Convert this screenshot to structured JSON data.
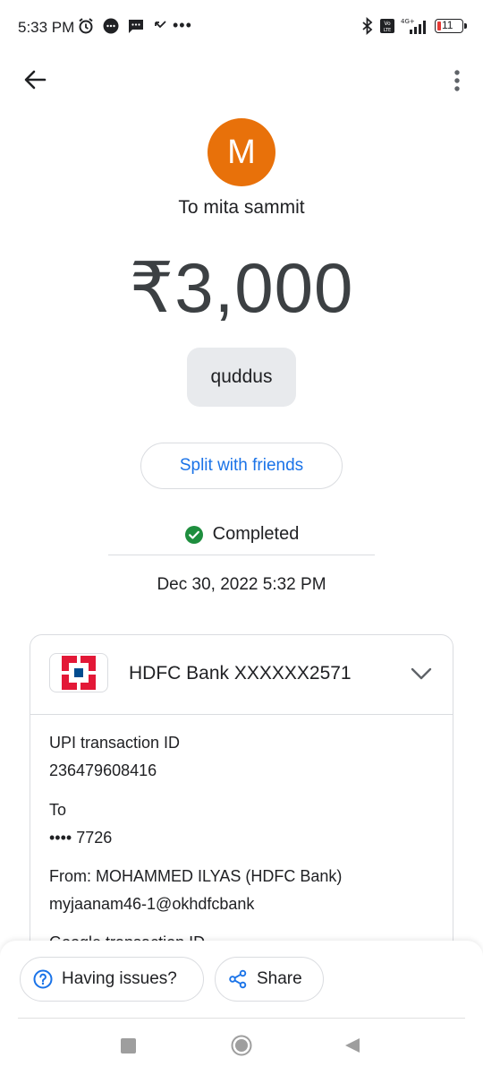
{
  "status_bar": {
    "time": "5:33 PM",
    "dots": "•••",
    "battery": "11"
  },
  "payee": {
    "avatar_initial": "M",
    "to_line": "To mita sammit"
  },
  "payment": {
    "amount": "₹3,000",
    "note": "quddus",
    "split_label": "Split with friends",
    "status": "Completed",
    "datetime": "Dec 30, 2022 5:32 PM"
  },
  "bank": {
    "name": "HDFC Bank XXXXXX2571",
    "details": [
      {
        "label": "UPI transaction ID",
        "value": "236479608416"
      },
      {
        "label": "To",
        "value": "•••• 7726"
      },
      {
        "label": "From: MOHAMMED ILYAS (HDFC Bank)",
        "value": "myjaanam46-1@okhdfcbank"
      },
      {
        "label": "Google transaction ID",
        "value": ""
      }
    ]
  },
  "actions": {
    "issues_label": "Having issues?",
    "share_label": "Share"
  },
  "colors": {
    "avatar": "#e8710a",
    "link": "#1a73e8",
    "success": "#1e8e3e",
    "hdfc_red": "#e31837",
    "hdfc_blue": "#004c8f"
  }
}
